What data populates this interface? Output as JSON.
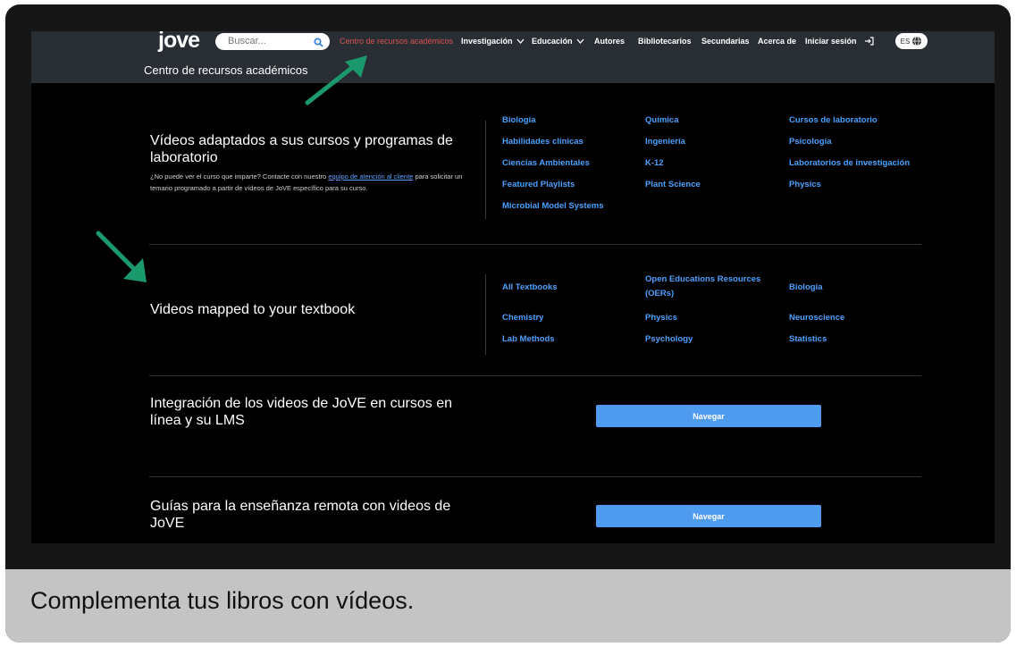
{
  "header": {
    "logo": "jove",
    "search_placeholder": "Buscar...",
    "nav_active": "Centro de recursos académicos",
    "nav_items": [
      "Investigación",
      "Educación",
      "Autores",
      "Bibliotecarios",
      "Secundarias",
      "Acerca de",
      "Iniciar sesión"
    ],
    "lang": "ES",
    "subtitle": "Centro de recursos académicos"
  },
  "section1": {
    "title": "Vídeos adaptados a sus cursos y programas de laboratorio",
    "desc_before": "¿No puede ver el curso que imparte? Contacte con nuestro ",
    "desc_link": "equipo de atención al cliente",
    "desc_after": " para solicitar un temario programado a partir de vídeos de JoVE específico para su curso.",
    "links": [
      "Biología",
      "Química",
      "Cursos de laboratorio",
      "Habilidades clínicas",
      "Ingeniería",
      "Psicología",
      "Ciencias Ambientales",
      "K-12",
      "Laboratorios de investigación",
      "Featured Playlists",
      "Plant Science",
      "Physics",
      "Microbial Model Systems"
    ]
  },
  "section2": {
    "title": "Videos mapped to your textbook",
    "links": [
      "All Textbooks",
      "Open Educations Resources (OERs)",
      "Biología",
      "Chemistry",
      "Physics",
      "Neuroscience",
      "Lab Methods",
      "Psychology",
      "Statistics"
    ]
  },
  "section3": {
    "title": "Integración de los videos de JoVE en cursos en línea y su LMS",
    "button": "Navegar"
  },
  "section4": {
    "title": "Guías para la enseñanza remota con videos de JoVE",
    "button": "Navegar"
  },
  "caption": "Complementa tus libros con vídeos.",
  "colors": {
    "accent_link": "#4ba1ff",
    "button": "#4e9bf0",
    "arrow": "#1a9a6c",
    "active_nav": "#d9534f"
  }
}
